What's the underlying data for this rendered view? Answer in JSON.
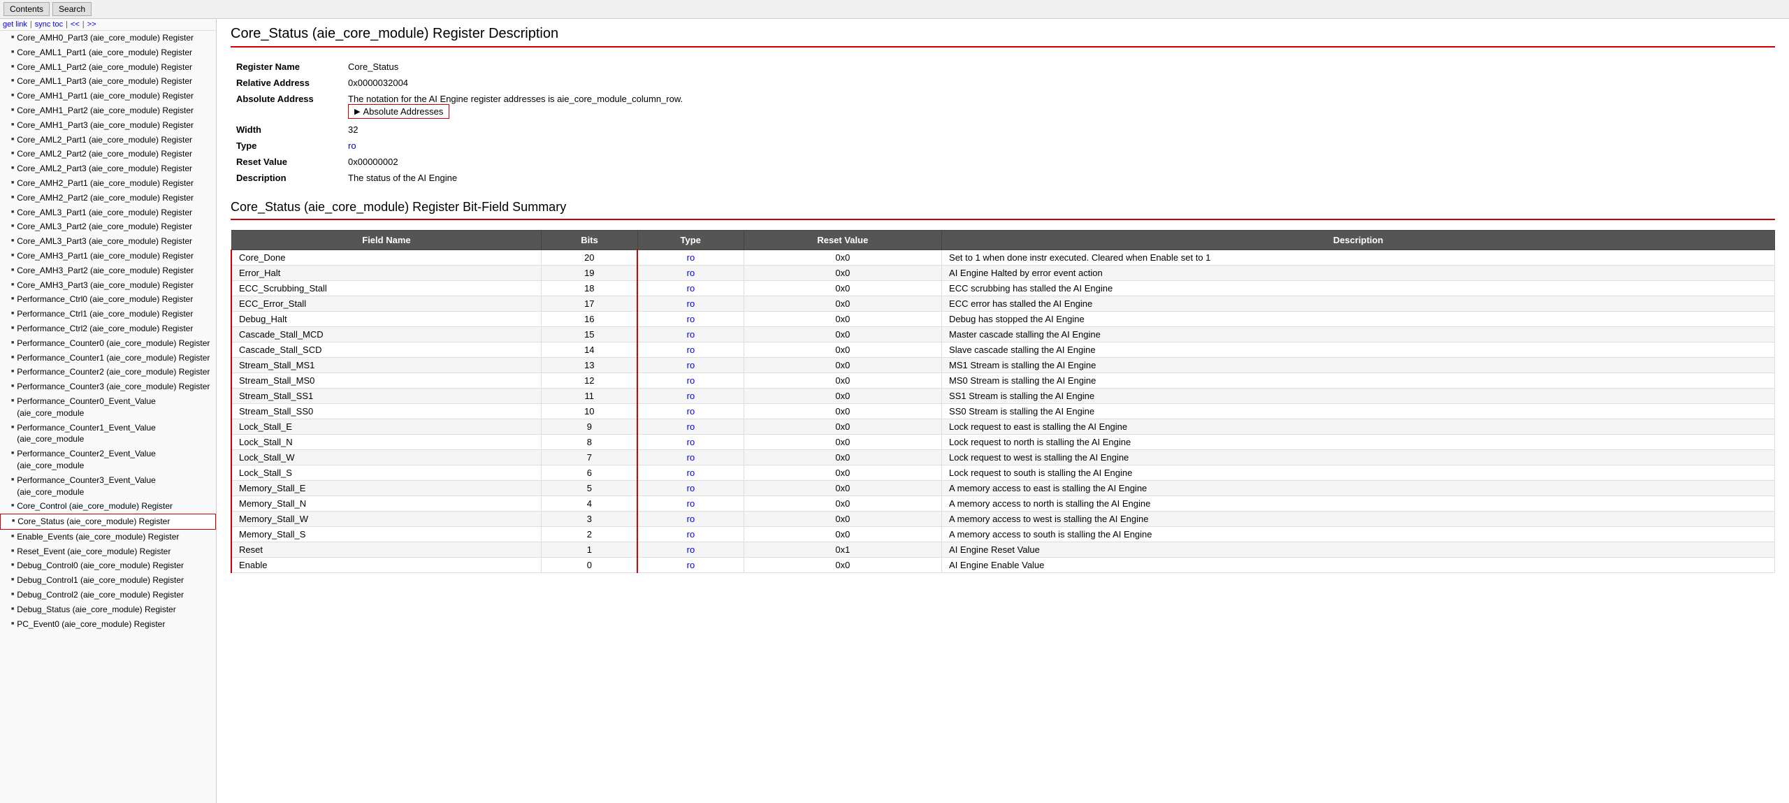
{
  "toolbar": {
    "contents_label": "Contents",
    "search_label": "Search"
  },
  "sidebar": {
    "nav": {
      "get_link": "get link",
      "sync_toc": "sync toc",
      "prev": "<<",
      "next": ">>"
    },
    "items": [
      {
        "label": "Core_AMH0_Part3 (aie_core_module) Register",
        "active": false
      },
      {
        "label": "Core_AML1_Part1 (aie_core_module) Register",
        "active": false
      },
      {
        "label": "Core_AML1_Part2 (aie_core_module) Register",
        "active": false
      },
      {
        "label": "Core_AML1_Part3 (aie_core_module) Register",
        "active": false
      },
      {
        "label": "Core_AMH1_Part1 (aie_core_module) Register",
        "active": false
      },
      {
        "label": "Core_AMH1_Part2 (aie_core_module) Register",
        "active": false
      },
      {
        "label": "Core_AMH1_Part3 (aie_core_module) Register",
        "active": false
      },
      {
        "label": "Core_AML2_Part1 (aie_core_module) Register",
        "active": false
      },
      {
        "label": "Core_AML2_Part2 (aie_core_module) Register",
        "active": false
      },
      {
        "label": "Core_AML2_Part3 (aie_core_module) Register",
        "active": false
      },
      {
        "label": "Core_AMH2_Part1 (aie_core_module) Register",
        "active": false
      },
      {
        "label": "Core_AMH2_Part2 (aie_core_module) Register",
        "active": false
      },
      {
        "label": "Core_AML3_Part1 (aie_core_module) Register",
        "active": false
      },
      {
        "label": "Core_AML3_Part2 (aie_core_module) Register",
        "active": false
      },
      {
        "label": "Core_AML3_Part3 (aie_core_module) Register",
        "active": false
      },
      {
        "label": "Core_AMH3_Part1 (aie_core_module) Register",
        "active": false
      },
      {
        "label": "Core_AMH3_Part2 (aie_core_module) Register",
        "active": false
      },
      {
        "label": "Core_AMH3_Part3 (aie_core_module) Register",
        "active": false
      },
      {
        "label": "Performance_Ctrl0 (aie_core_module) Register",
        "active": false
      },
      {
        "label": "Performance_Ctrl1 (aie_core_module) Register",
        "active": false
      },
      {
        "label": "Performance_Ctrl2 (aie_core_module) Register",
        "active": false
      },
      {
        "label": "Performance_Counter0 (aie_core_module) Register",
        "active": false
      },
      {
        "label": "Performance_Counter1 (aie_core_module) Register",
        "active": false
      },
      {
        "label": "Performance_Counter2 (aie_core_module) Register",
        "active": false
      },
      {
        "label": "Performance_Counter3 (aie_core_module) Register",
        "active": false
      },
      {
        "label": "Performance_Counter0_Event_Value (aie_core_module",
        "active": false
      },
      {
        "label": "Performance_Counter1_Event_Value (aie_core_module",
        "active": false
      },
      {
        "label": "Performance_Counter2_Event_Value (aie_core_module",
        "active": false
      },
      {
        "label": "Performance_Counter3_Event_Value (aie_core_module",
        "active": false
      },
      {
        "label": "Core_Control (aie_core_module) Register",
        "active": false
      },
      {
        "label": "Core_Status (aie_core_module) Register",
        "active": true
      },
      {
        "label": "Enable_Events (aie_core_module) Register",
        "active": false
      },
      {
        "label": "Reset_Event (aie_core_module) Register",
        "active": false
      },
      {
        "label": "Debug_Control0 (aie_core_module) Register",
        "active": false
      },
      {
        "label": "Debug_Control1 (aie_core_module) Register",
        "active": false
      },
      {
        "label": "Debug_Control2 (aie_core_module) Register",
        "active": false
      },
      {
        "label": "Debug_Status (aie_core_module) Register",
        "active": false
      },
      {
        "label": "PC_Event0 (aie_core_module) Register",
        "active": false
      }
    ]
  },
  "content": {
    "page_title": "Core_Status (aie_core_module) Register Description",
    "register_info": {
      "name_label": "Register Name",
      "name_value": "Core_Status",
      "rel_addr_label": "Relative Address",
      "rel_addr_value": "0x0000032004",
      "abs_addr_label": "Absolute Address",
      "abs_addr_note": "The notation for the AI Engine register addresses is aie_core_module_column_row.",
      "abs_addr_button": "▶ Absolute Addresses",
      "width_label": "Width",
      "width_value": "32",
      "type_label": "Type",
      "type_value": "ro",
      "reset_label": "Reset Value",
      "reset_value": "0x00000002",
      "desc_label": "Description",
      "desc_value": "The status of the AI Engine"
    },
    "section_title": "Core_Status (aie_core_module) Register Bit-Field Summary",
    "table": {
      "headers": [
        "Field Name",
        "Bits",
        "Type",
        "Reset Value",
        "Description"
      ],
      "rows": [
        {
          "field": "Core_Done",
          "bits": "20",
          "type": "ro",
          "reset": "0x0",
          "desc": "Set to 1 when done instr executed. Cleared when Enable set to 1"
        },
        {
          "field": "Error_Halt",
          "bits": "19",
          "type": "ro",
          "reset": "0x0",
          "desc": "AI Engine Halted by error event action"
        },
        {
          "field": "ECC_Scrubbing_Stall",
          "bits": "18",
          "type": "ro",
          "reset": "0x0",
          "desc": "ECC scrubbing has stalled the AI Engine"
        },
        {
          "field": "ECC_Error_Stall",
          "bits": "17",
          "type": "ro",
          "reset": "0x0",
          "desc": "ECC error has stalled the AI Engine"
        },
        {
          "field": "Debug_Halt",
          "bits": "16",
          "type": "ro",
          "reset": "0x0",
          "desc": "Debug has stopped the AI Engine"
        },
        {
          "field": "Cascade_Stall_MCD",
          "bits": "15",
          "type": "ro",
          "reset": "0x0",
          "desc": "Master cascade stalling the AI Engine"
        },
        {
          "field": "Cascade_Stall_SCD",
          "bits": "14",
          "type": "ro",
          "reset": "0x0",
          "desc": "Slave cascade stalling the AI Engine"
        },
        {
          "field": "Stream_Stall_MS1",
          "bits": "13",
          "type": "ro",
          "reset": "0x0",
          "desc": "MS1 Stream is stalling the AI Engine"
        },
        {
          "field": "Stream_Stall_MS0",
          "bits": "12",
          "type": "ro",
          "reset": "0x0",
          "desc": "MS0 Stream is stalling the AI Engine"
        },
        {
          "field": "Stream_Stall_SS1",
          "bits": "11",
          "type": "ro",
          "reset": "0x0",
          "desc": "SS1 Stream is stalling the AI Engine"
        },
        {
          "field": "Stream_Stall_SS0",
          "bits": "10",
          "type": "ro",
          "reset": "0x0",
          "desc": "SS0 Stream is stalling the AI Engine"
        },
        {
          "field": "Lock_Stall_E",
          "bits": "9",
          "type": "ro",
          "reset": "0x0",
          "desc": "Lock request to east is stalling the AI Engine"
        },
        {
          "field": "Lock_Stall_N",
          "bits": "8",
          "type": "ro",
          "reset": "0x0",
          "desc": "Lock request to north is stalling the AI Engine"
        },
        {
          "field": "Lock_Stall_W",
          "bits": "7",
          "type": "ro",
          "reset": "0x0",
          "desc": "Lock request to west is stalling the AI Engine"
        },
        {
          "field": "Lock_Stall_S",
          "bits": "6",
          "type": "ro",
          "reset": "0x0",
          "desc": "Lock request to south is stalling the AI Engine"
        },
        {
          "field": "Memory_Stall_E",
          "bits": "5",
          "type": "ro",
          "reset": "0x0",
          "desc": "A memory access to east is stalling the AI Engine"
        },
        {
          "field": "Memory_Stall_N",
          "bits": "4",
          "type": "ro",
          "reset": "0x0",
          "desc": "A memory access to north is stalling the AI Engine"
        },
        {
          "field": "Memory_Stall_W",
          "bits": "3",
          "type": "ro",
          "reset": "0x0",
          "desc": "A memory access to west is stalling the AI Engine"
        },
        {
          "field": "Memory_Stall_S",
          "bits": "2",
          "type": "ro",
          "reset": "0x0",
          "desc": "A memory access to south is stalling the AI Engine"
        },
        {
          "field": "Reset",
          "bits": "1",
          "type": "ro",
          "reset": "0x1",
          "desc": "AI Engine Reset Value"
        },
        {
          "field": "Enable",
          "bits": "0",
          "type": "ro",
          "reset": "0x0",
          "desc": "AI Engine Enable Value"
        }
      ]
    }
  }
}
